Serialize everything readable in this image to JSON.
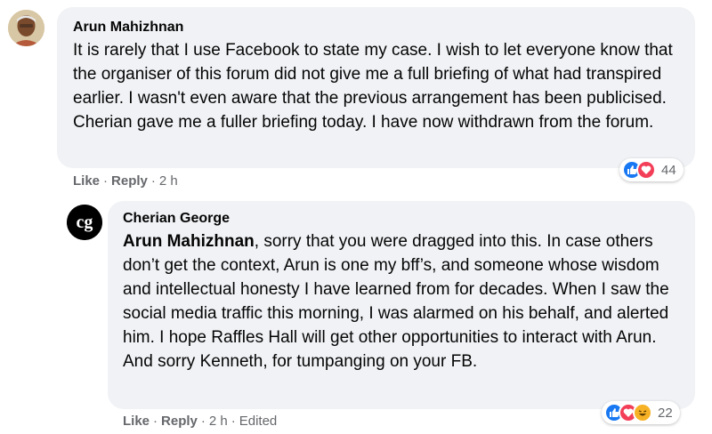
{
  "comments": [
    {
      "author": "Arun Mahizhnan",
      "text": "It is rarely that I use Facebook to state my case. I wish to let everyone know that the organiser of this forum did not give me a full briefing of what had transpired earlier. I wasn't even aware that the previous arrangement has been publicised. Cherian gave me a fuller briefing today. I have now withdrawn from the forum.",
      "like_label": "Like",
      "reply_label": "Reply",
      "time": "2 h",
      "reactions": {
        "icons": [
          "like-icon",
          "love-icon"
        ],
        "count": "44"
      }
    },
    {
      "author": "Cherian George",
      "mention": "Arun Mahizhnan",
      "text": ", sorry that you were dragged into this. In case others don’t get the context, Arun is one my bff’s, and someone whose wisdom and intellectual honesty I have learned from for decades. When I saw the social media traffic this morning, I was alarmed on his behalf, and alerted him. I hope Raffles Hall will get other opportunities to interact with Arun. And sorry Kenneth, for tumpanging on your FB.",
      "like_label": "Like",
      "reply_label": "Reply",
      "time": "2 h",
      "edited_label": "Edited",
      "reactions": {
        "icons": [
          "like-icon",
          "love-icon",
          "haha-icon"
        ],
        "count": "22"
      }
    }
  ],
  "separator": "·",
  "avatar2_initials": "cg",
  "colors": {
    "bubble_bg": "#f0f2f5",
    "meta_text": "#65676b",
    "like": "#1877f2",
    "love": "#f33e58",
    "haha": "#f7b125"
  }
}
